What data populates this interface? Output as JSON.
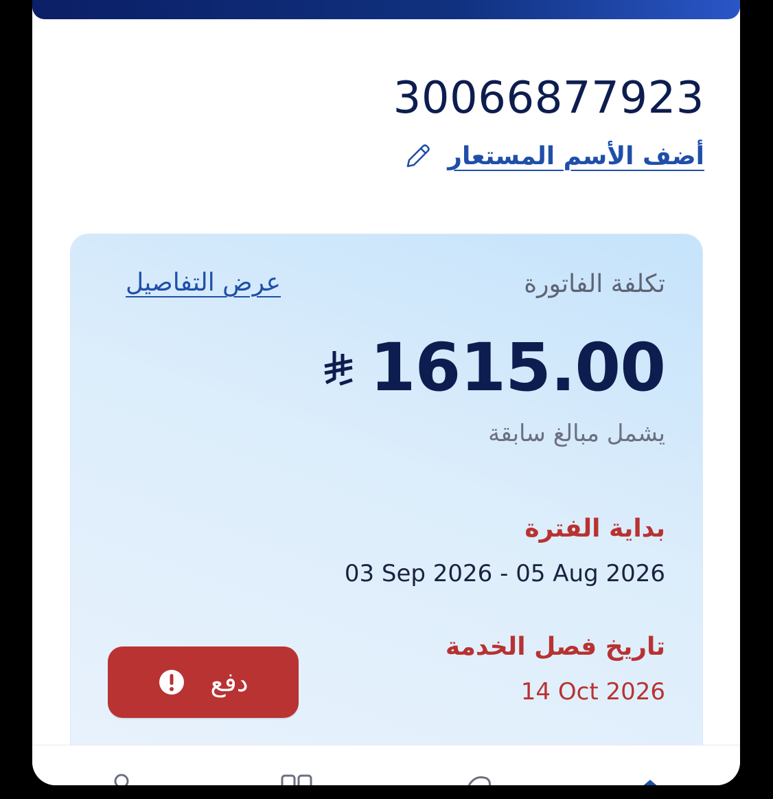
{
  "account": {
    "number": "30066877923",
    "nickname_link": "أضف الأسم المستعار"
  },
  "bill": {
    "title": "تكلفة الفاتورة",
    "details_link": "عرض التفاصيل",
    "amount": "1615.00",
    "currency_icon": "saudi-riyal-icon",
    "amount_note": "يشمل مبالغ سابقة",
    "period_label": "بداية الفترة",
    "period_value": "03 Sep 2026 - 05 Aug 2026",
    "disconnect_label": "تاريخ فصل الخدمة",
    "disconnect_value": "14 Oct 2026",
    "pay_label": "دفع"
  },
  "colors": {
    "primary_navy": "#0e1d4f",
    "link_blue": "#1f4fa8",
    "alert_red": "#b93333",
    "card_bg": "#d6eafb"
  },
  "nav": {
    "items": [
      "person-icon",
      "grid-icon",
      "chat-icon",
      "home-icon"
    ]
  }
}
